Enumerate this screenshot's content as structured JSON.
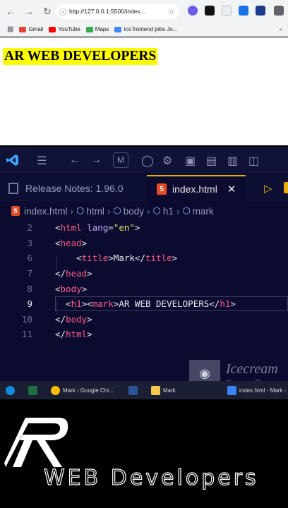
{
  "browser": {
    "url": "http://127.0.0.1:5500/index...",
    "bookmarks": [
      {
        "label": "Gmail",
        "color": "#ea4335"
      },
      {
        "label": "YouTube",
        "color": "#ff0000"
      },
      {
        "label": "Maps",
        "color": "#34a853"
      },
      {
        "label": "tcs frontend jobs Jo...",
        "color": "#4285f4"
      }
    ],
    "page_heading": "AR WEB DEVELOPERS"
  },
  "vscode": {
    "tabs": [
      {
        "label": "Release Notes: 1.96.0"
      },
      {
        "label": "index.html"
      }
    ],
    "breadcrumb": [
      "index.html",
      "html",
      "body",
      "h1",
      "mark"
    ],
    "lines": [
      {
        "num": "2",
        "parts": [
          [
            "punc",
            "<"
          ],
          [
            "tag",
            "html"
          ],
          [
            "punc",
            " "
          ],
          [
            "attr",
            "lang"
          ],
          [
            "punc",
            "="
          ],
          [
            "str",
            "\"en\""
          ],
          [
            "punc",
            ">"
          ]
        ]
      },
      {
        "num": "3",
        "parts": [
          [
            "punc",
            "<"
          ],
          [
            "tag",
            "head"
          ],
          [
            "punc",
            ">"
          ]
        ]
      },
      {
        "num": "6",
        "parts": [
          [
            "punc",
            "    <"
          ],
          [
            "tag",
            "title"
          ],
          [
            "punc",
            ">"
          ],
          [
            "text",
            "Mark"
          ],
          [
            "punc",
            "</"
          ],
          [
            "tag",
            "title"
          ],
          [
            "punc",
            ">"
          ]
        ]
      },
      {
        "num": "7",
        "parts": [
          [
            "punc",
            "</"
          ],
          [
            "tag",
            "head"
          ],
          [
            "punc",
            ">"
          ]
        ]
      },
      {
        "num": "8",
        "parts": [
          [
            "punc",
            "<"
          ],
          [
            "tag",
            "body"
          ],
          [
            "punc",
            ">"
          ]
        ]
      },
      {
        "num": "9",
        "parts": [
          [
            "punc",
            "  <"
          ],
          [
            "tag",
            "h1"
          ],
          [
            "punc",
            "><"
          ],
          [
            "tag",
            "mark"
          ],
          [
            "punc",
            ">"
          ],
          [
            "text",
            "AR WEB DEVELOPERS"
          ],
          [
            "punc",
            "</"
          ],
          [
            "tag",
            "h1"
          ],
          [
            "punc",
            ">"
          ]
        ]
      },
      {
        "num": "10",
        "parts": [
          [
            "punc",
            "</"
          ],
          [
            "tag",
            "body"
          ],
          [
            "punc",
            ">"
          ]
        ]
      },
      {
        "num": "11",
        "parts": [
          [
            "punc",
            "</"
          ],
          [
            "tag",
            "html"
          ],
          [
            "punc",
            ">"
          ]
        ]
      }
    ],
    "current_line": "9"
  },
  "watermark": {
    "line1": "Icecream",
    "line2": "Screen Re"
  },
  "taskbar": {
    "items": [
      {
        "label": "Mark - Google Chr...",
        "color": "#fbbc05"
      },
      {
        "label": "Mark",
        "color": "#f2c94c"
      },
      {
        "label": "index.html - Mark -",
        "color": "#3b82f6"
      }
    ]
  },
  "brand": {
    "text": "WEB Developers",
    "logo_letter": "R"
  }
}
